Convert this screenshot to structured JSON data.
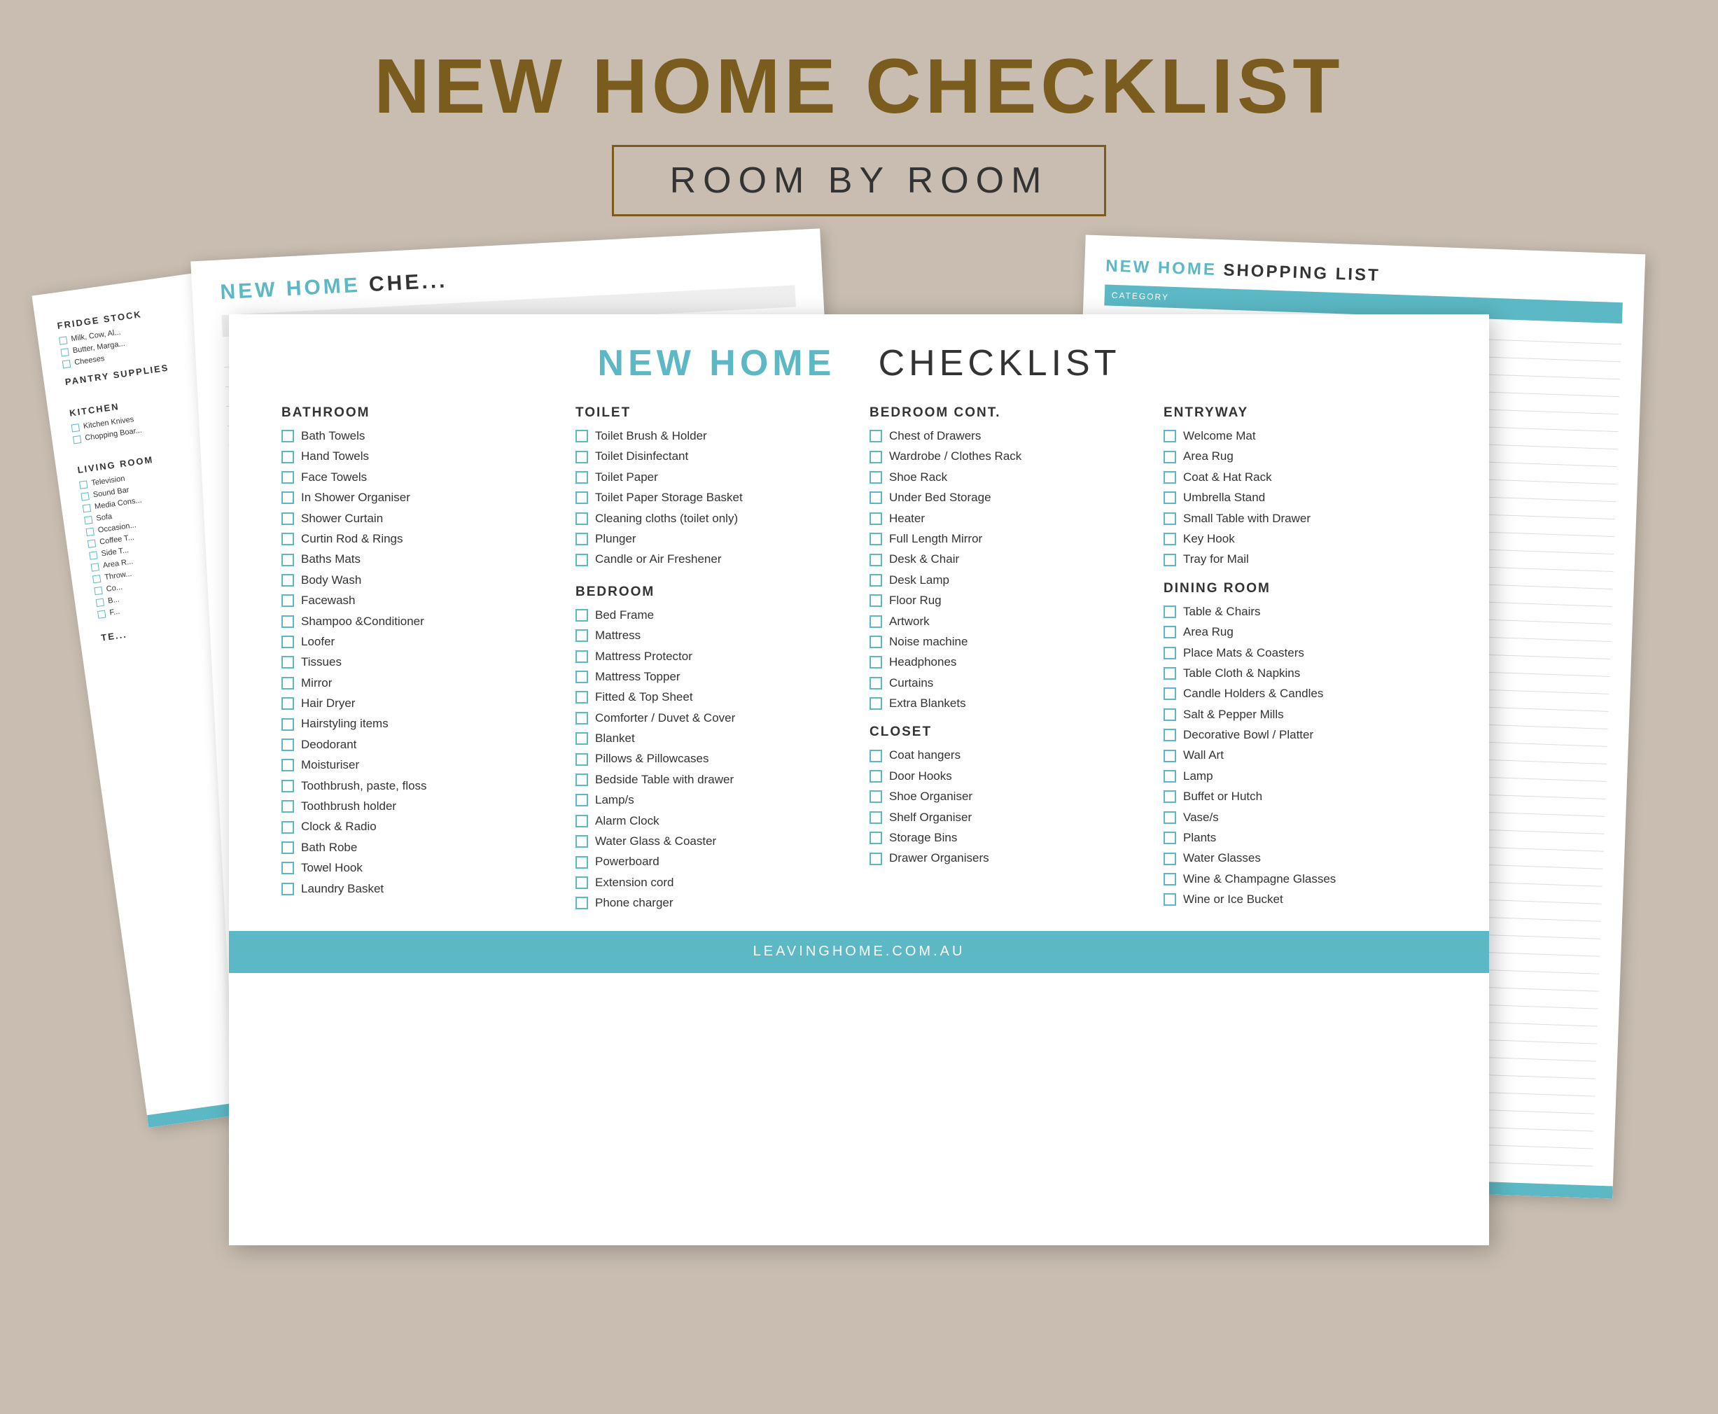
{
  "page": {
    "title": "NEW HOME CHECKLIST",
    "subtitle": "ROOM BY ROOM",
    "background_color": "#c8bdb0",
    "footer_url": "LEAVINGHOME.COM.AU"
  },
  "back_left_paper": {
    "sections": [
      {
        "title": "FRIDGE STOCK",
        "items": [
          "Milk, Cow, Al...",
          "Butter, Marga...",
          "Cheeses"
        ]
      },
      {
        "title": "PANTRY SUPPLIES",
        "items": []
      },
      {
        "title": "KITCHEN",
        "items": [
          "Kitchen Knives",
          "Chopping Boar..."
        ]
      },
      {
        "title": "LIVING ROOM",
        "items": [
          "Television",
          "Sound Bar",
          "Media Cons...",
          "Sofa",
          "Occasion...",
          "Coffee T...",
          "Side T...",
          "Area R...",
          "Throw...",
          "Co...",
          "B...",
          "F..."
        ]
      },
      {
        "title": "TE...",
        "items": []
      }
    ]
  },
  "back_center_paper": {
    "title": "NEW HOME CHE...",
    "subtitle": "CATEGORY"
  },
  "back_right_paper": {
    "title": "NEW HOME SHOPPING LIST",
    "columns": [
      "CATEGORY",
      "",
      "",
      "",
      ""
    ]
  },
  "main_checklist": {
    "title_teal": "NEW HOME",
    "title_plain": "CHECKLIST",
    "columns": [
      {
        "id": "bathroom",
        "title": "BATHROOM",
        "items": [
          "Bath Towels",
          "Hand Towels",
          "Face Towels",
          "In Shower Organiser",
          "Shower Curtain",
          "Curtin Rod & Rings",
          "Baths Mats",
          "Body Wash",
          "Facewash",
          "Shampoo & Conditioner",
          "Loofer",
          "Tissues",
          "Mirror",
          "Hair Dryer",
          "Hairstyling items",
          "Deodorant",
          "Moisturiser",
          "Toothbrush, paste, floss",
          "Toothbrush holder",
          "Clock & Radio",
          "Bath Robe",
          "Towel Hook",
          "Laundry Basket"
        ]
      },
      {
        "id": "toilet",
        "title": "TOILET",
        "items": [
          "Toilet Brush & Holder",
          "Toilet Disinfectant",
          "Toilet Paper",
          "Toilet Paper Storage Basket",
          "Cleaning cloths (toilet only)",
          "Plunger",
          "Candle or Air Freshener"
        ],
        "section2_title": "BEDROOM",
        "section2_items": [
          "Bed Frame",
          "Mattress",
          "Mattress Protector",
          "Mattress Topper",
          "Fitted & Top Sheet",
          "Comforter / Duvet & Cover",
          "Blanket",
          "Pillows & Pillowcases",
          "Bedside Table with drawer",
          "Lamp/s",
          "Alarm Clock",
          "Water Glass & Coaster",
          "Powerboard",
          "Extension cord",
          "Phone charger"
        ]
      },
      {
        "id": "bedroom_cont",
        "title": "BEDROOM CONT.",
        "items": [
          "Chest of Drawers",
          "Wardrobe / Clothes Rack",
          "Shoe Rack",
          "Under Bed Storage",
          "Heater",
          "Full Length Mirror",
          "Desk & Chair",
          "Desk Lamp",
          "Floor Rug",
          "Artwork",
          "Noise machine",
          "Headphones",
          "Curtains",
          "Extra Blankets"
        ],
        "section2_title": "CLOSET",
        "section2_items": [
          "Coat hangers",
          "Door Hooks",
          "Shoe Organiser",
          "Shelf Organiser",
          "Storage Bins",
          "Drawer Organisers"
        ]
      },
      {
        "id": "entryway",
        "title": "ENTRYWAY",
        "items": [
          "Welcome Mat",
          "Area Rug",
          "Coat & Hat Rack",
          "Umbrella Stand",
          "Small Table with Drawer",
          "Key Hook",
          "Tray for Mail"
        ],
        "section2_title": "DINING ROOM",
        "section2_items": [
          "Table & Chairs",
          "Area Rug",
          "Place Mats & Coasters",
          "Table Cloth & Napkins",
          "Candle Holders & Candles",
          "Salt & Pepper Mills",
          "Decorative Bowl / Platter",
          "Wall Art",
          "Lamp",
          "Buffet or Hutch",
          "Vase/s",
          "Plants",
          "Water Glasses",
          "Wine & Champagne Glasses",
          "Wine or Ice Bucket"
        ]
      }
    ]
  }
}
